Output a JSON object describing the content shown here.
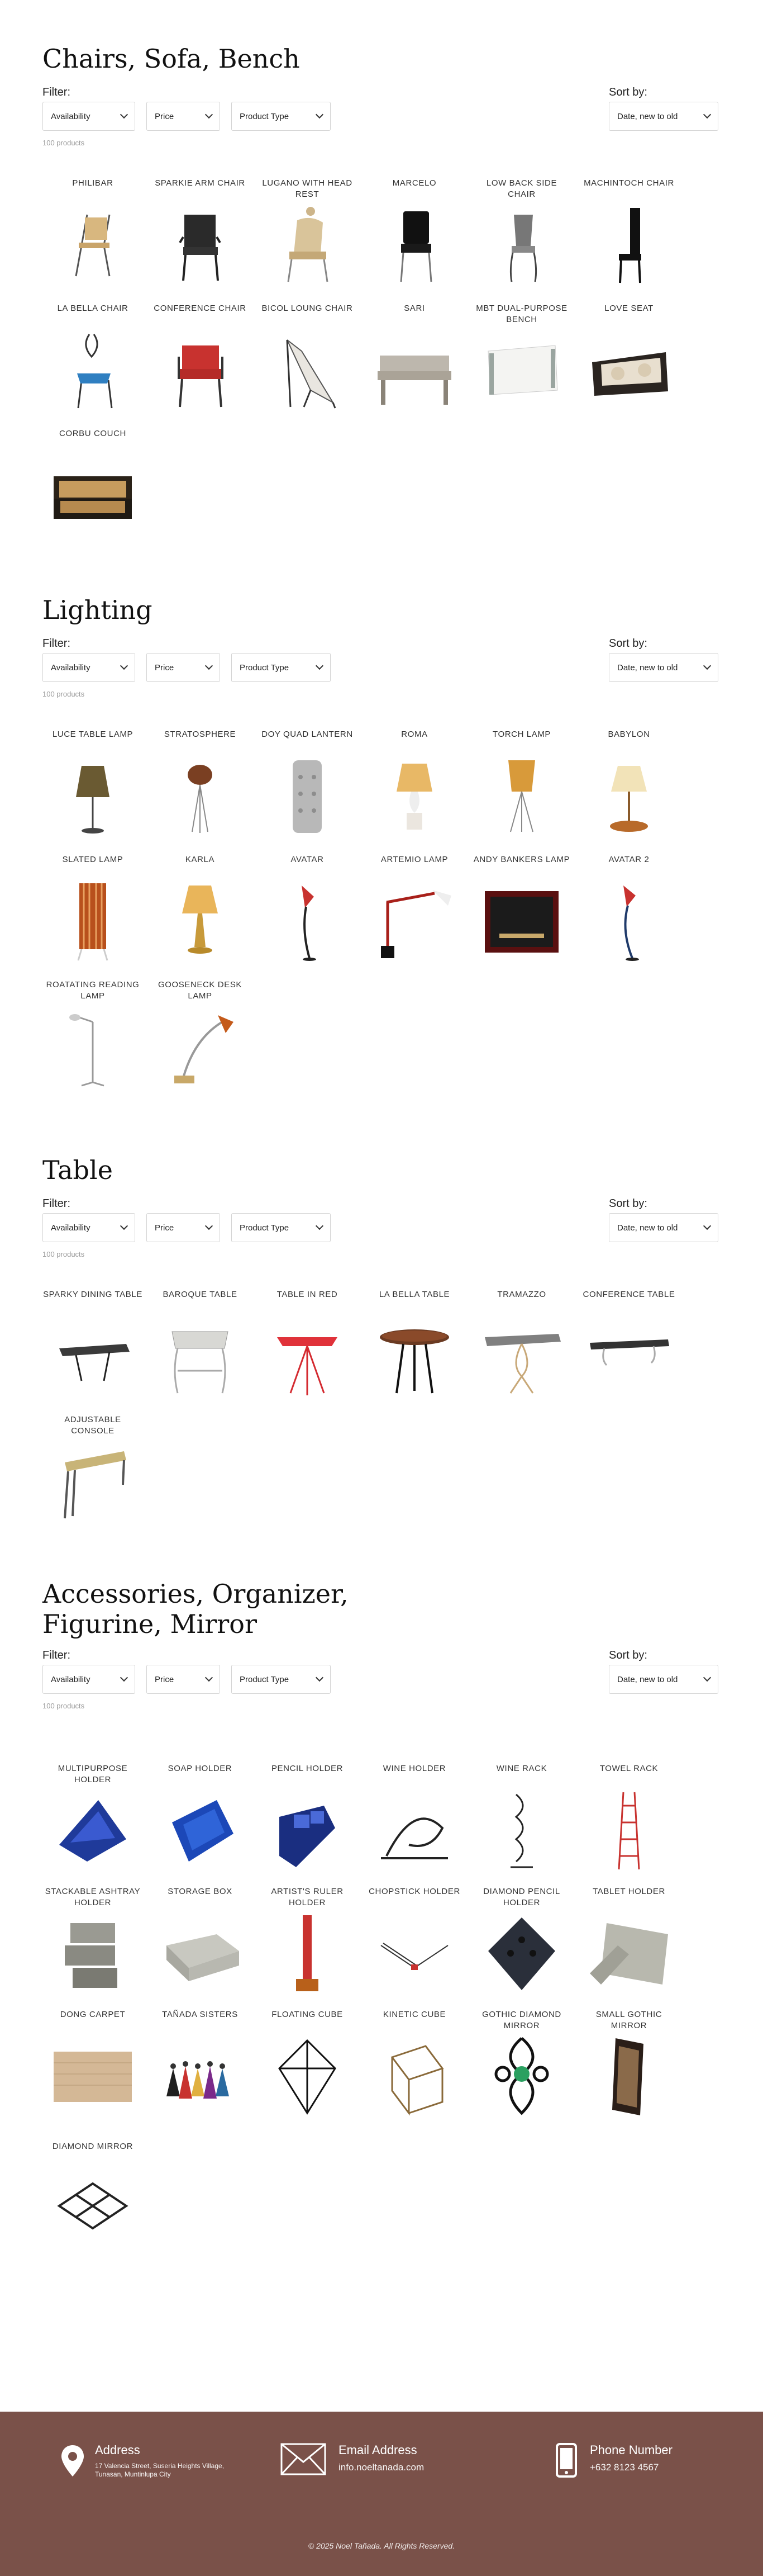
{
  "chairs": {
    "title": "Chairs, Sofa, Bench",
    "filter_label": "Filter:",
    "sort_label": "Sort by:",
    "filters": [
      "Availability",
      "Price",
      "Product Type"
    ],
    "sort_value": "Date, new to old",
    "count": "100 products",
    "items": [
      "PHILIBAR",
      "SPARKIE ARM CHAIR",
      "LUGANO WITH HEAD REST",
      "MARCELO",
      "LOW BACK SIDE CHAIR",
      "MACHINTOCH CHAIR",
      "LA BELLA CHAIR",
      "CONFERENCE CHAIR",
      "BICOL LOUNG CHAIR",
      "SARI",
      "MBT DUAL-PURPOSE BENCH",
      "LOVE SEAT",
      "CORBU COUCH"
    ]
  },
  "lighting": {
    "title": "Lighting",
    "filter_label": "Filter:",
    "sort_label": "Sort by:",
    "filters": [
      "Availability",
      "Price",
      "Product Type"
    ],
    "sort_value": "Date, new to old",
    "count": "100 products",
    "items": [
      "LUCE TABLE LAMP",
      "STRATOSPHERE",
      "DOY QUAD LANTERN",
      "ROMA",
      "TORCH LAMP",
      "BABYLON",
      "SLATED LAMP",
      "KARLA",
      "AVATAR",
      "ARTEMIO LAMP",
      "ANDY BANKERS LAMP",
      "AVATAR 2",
      "ROATATING READING LAMP",
      "GOOSENECK DESK LAMP"
    ]
  },
  "table": {
    "title": "Table",
    "filter_label": "Filter:",
    "sort_label": "Sort by:",
    "filters": [
      "Availability",
      "Price",
      "Product Type"
    ],
    "sort_value": "Date, new to old",
    "count": "100 products",
    "items": [
      "SPARKY DINING TABLE",
      "BAROQUE TABLE",
      "TABLE IN RED",
      "LA BELLA TABLE",
      "TRAMAZZO",
      "CONFERENCE TABLE",
      "ADJUSTABLE CONSOLE"
    ]
  },
  "accessories": {
    "title_line1": "Accessories, Organizer,",
    "title_line2": "Figurine, Mirror",
    "filter_label": "Filter:",
    "sort_label": "Sort by:",
    "filters": [
      "Availability",
      "Price",
      "Product Type"
    ],
    "sort_value": "Date, new to old",
    "count": "100 products",
    "items": [
      "MULTIPURPOSE HOLDER",
      "SOAP HOLDER",
      "PENCIL HOLDER",
      "WINE HOLDER",
      "WINE RACK",
      "TOWEL RACK",
      "STACKABLE ASHTRAY HOLDER",
      "STORAGE BOX",
      "ARTIST'S RULER HOLDER",
      "CHOPSTICK HOLDER",
      "DIAMOND PENCIL HOLDER",
      "TABLET HOLDER",
      "DONG CARPET",
      "TAÑADA SISTERS",
      "FLOATING CUBE",
      "KINETIC CUBE",
      "GOTHIC DIAMOND MIRROR",
      "SMALL GOTHIC MIRROR",
      "DIAMOND MIRROR"
    ]
  },
  "footer": {
    "address_title": "Address",
    "address_line1": "17 Valencia Street, Suseria Heights Village,",
    "address_line2": "Tunasan, Muntinlupa City",
    "email_title": "Email Address",
    "email_value": "info.noeltanada.com",
    "phone_title": "Phone Number",
    "phone_value": "+632 8123 4567",
    "copyright": "© 2025 Noel Tañada. All Rights Reserved."
  }
}
